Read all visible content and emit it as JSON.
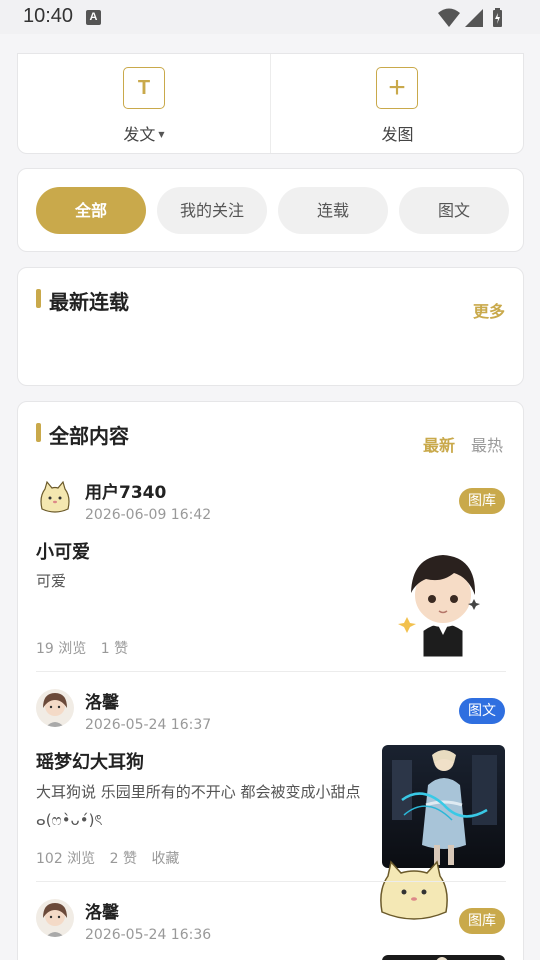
{
  "status": {
    "time": "10:40",
    "indicator": "A"
  },
  "post_actions": {
    "text": {
      "icon": "T",
      "label": "发文"
    },
    "image": {
      "icon": "+",
      "label": "发图"
    }
  },
  "filters": [
    "全部",
    "我的关注",
    "连载",
    "图文"
  ],
  "latest_serial": {
    "title": "最新连载",
    "more": "更多"
  },
  "all_content": {
    "title": "全部内容",
    "sort_newest": "最新",
    "sort_hot": "最热",
    "items": [
      {
        "author": "用户7340",
        "time": "2026-06-09 16:42",
        "badge": "图库",
        "title": "小可爱",
        "desc": "可爱",
        "views": "19 浏览",
        "likes": "1 赞",
        "fav": ""
      },
      {
        "author": "洛馨",
        "time": "2026-05-24 16:37",
        "badge": "图文",
        "title": "瑶梦幻大耳狗",
        "desc": "大耳狗说 乐园里所有的不开心 都会被变成小甜点ⴰ(ෆ•̀ᴗ•́)ৎ",
        "views": "102 浏览",
        "likes": "2 赞",
        "fav": "收藏"
      },
      {
        "author": "洛馨",
        "time": "2026-05-24 16:36",
        "badge": "图库"
      }
    ]
  },
  "colors": {
    "accent": "#c9a94b",
    "blue_badge": "#2f6fe0"
  }
}
